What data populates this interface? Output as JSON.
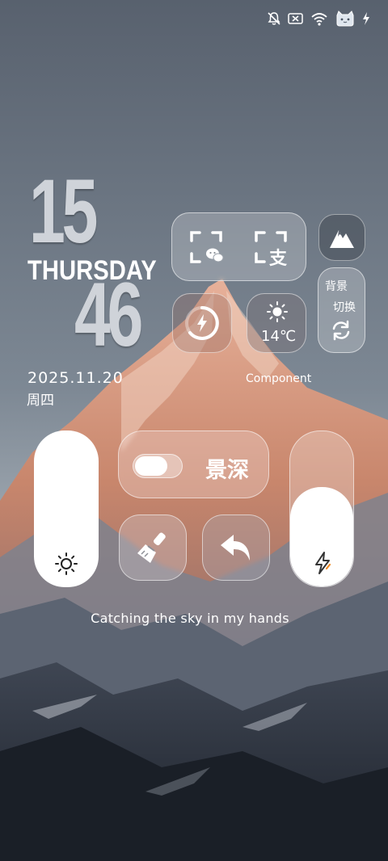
{
  "status_bar": {
    "icons": [
      "mute-icon",
      "sim-disabled-icon",
      "wifi-icon",
      "battery-cat-icon",
      "charging-bolt-icon"
    ]
  },
  "clock": {
    "hour": "15",
    "minute": "46",
    "day_name": "THURSDAY",
    "date": "2025.11.20",
    "weekday_cn": "周四"
  },
  "scan_widget": {
    "wechat_scan_icon": "wechat-scan-icon",
    "alipay_scan_icon": "alipay-scan-icon",
    "alipay_char": "支"
  },
  "mountain_button": {
    "icon": "mountain-icon"
  },
  "wallpaper_switch": {
    "line1": "背景",
    "line2": "切换",
    "icon": "refresh-icon"
  },
  "charge_widget": {
    "icon": "charging-ring-icon"
  },
  "weather_widget": {
    "icon": "sun-icon",
    "temperature": "14℃"
  },
  "component_label": "Component",
  "depth_toggle": {
    "label": "景深",
    "state": "off"
  },
  "brightness_slider": {
    "icon": "brightness-icon",
    "level": 1.0
  },
  "power_slider": {
    "icon": "lightning-icon",
    "level": 0.55
  },
  "clean_button": {
    "icon": "broom-icon"
  },
  "back_button": {
    "icon": "undo-arrow-icon"
  },
  "caption": "Catching the sky in my hands",
  "colors": {
    "sky_top": "#5d6775",
    "sky_bottom": "#9aa3ad",
    "peak_glow": "#d99a80",
    "accent_orange": "#f08a24"
  }
}
